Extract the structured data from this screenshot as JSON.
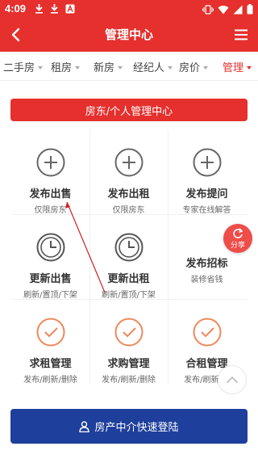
{
  "status_bar": {
    "time": "4:09",
    "left_icons": [
      "download-icon",
      "download-icon",
      "a-notification-icon"
    ],
    "right_icons": [
      "vibrate-icon",
      "wifi-icon",
      "signal-icon",
      "battery-icon"
    ]
  },
  "header": {
    "title": "管理中心",
    "back_icon": "back-arrow-icon",
    "menu_icon": "hamburger-menu-icon",
    "color": "#e5302e"
  },
  "tabs": [
    {
      "label": "二手房",
      "active": false
    },
    {
      "label": "租房",
      "active": false
    },
    {
      "label": "新房",
      "active": false
    },
    {
      "label": "经纪人",
      "active": false
    },
    {
      "label": "房价",
      "active": false
    },
    {
      "label": "管理",
      "active": true
    }
  ],
  "banner": {
    "label": "房东/个人管理中心"
  },
  "grid": [
    {
      "title": "发布出售",
      "subtitle": "仅限房东",
      "icon": "plus-circle-icon"
    },
    {
      "title": "发布出租",
      "subtitle": "仅限房东",
      "icon": "plus-circle-icon"
    },
    {
      "title": "发布提问",
      "subtitle": "专家在线解答",
      "icon": "plus-circle-icon"
    },
    {
      "title": "更新出售",
      "subtitle": "刷新/置顶/下架",
      "icon": "clock-icon"
    },
    {
      "title": "更新出租",
      "subtitle": "刷新/置顶/下架",
      "icon": "clock-icon"
    },
    {
      "title": "发布招标",
      "subtitle": "装修省钱",
      "icon": "none"
    },
    {
      "title": "求租管理",
      "subtitle": "发布/刷新/删除",
      "icon": "check-circle-icon"
    },
    {
      "title": "求购管理",
      "subtitle": "发布/刷新/删除",
      "icon": "check-circle-icon"
    },
    {
      "title": "合租管理",
      "subtitle": "发布/刷新/删",
      "icon": "check-circle-icon"
    }
  ],
  "share": {
    "label": "分享",
    "icon": "share-refresh-icon"
  },
  "scroll_top": {
    "icon": "chevron-up-icon"
  },
  "login_button": {
    "label": "房产中介快速登陆",
    "icon": "user-icon",
    "color": "#1e3f9c"
  },
  "colors": {
    "accent": "#e5302e",
    "check": "#f0875a",
    "icon_gray": "#666666"
  }
}
